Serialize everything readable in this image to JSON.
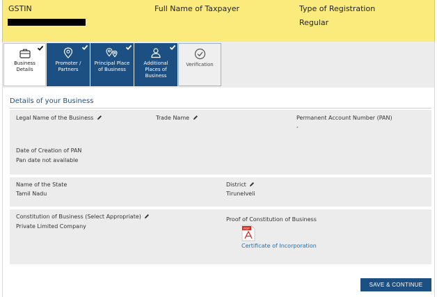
{
  "header": {
    "gstin_label": "GSTIN",
    "taxpayer_name_label": "Full Name of Taxpayer",
    "registration_type_label": "Type of Registration",
    "registration_type_value": "Regular"
  },
  "tabs": [
    {
      "label": "Business Details",
      "completed": true,
      "icon": "briefcase-icon"
    },
    {
      "label": "Promoter / Partners",
      "completed": true,
      "icon": "location-pin-icon"
    },
    {
      "label": "Principal Place of Business",
      "completed": true,
      "icon": "multi-location-icon"
    },
    {
      "label": "Additional Places of Business",
      "completed": true,
      "icon": "person-location-icon"
    },
    {
      "label": "Verification",
      "completed": false,
      "icon": "check-circle-icon"
    }
  ],
  "section": {
    "title": "Details of your Business"
  },
  "fields": {
    "legal_name_label": "Legal Name of the Business",
    "trade_name_label": "Trade Name",
    "pan_label": "Permanent Account Number (PAN)",
    "pan_value": ",",
    "pan_date_label": "Date of Creation of PAN",
    "pan_date_value": "Pan date not available",
    "state_label": "Name of the State",
    "state_value": "Tamil Nadu",
    "district_label": "District",
    "district_value": "Tirunelveli",
    "constitution_label": "Constitution of Business (Select Appropriate)",
    "constitution_value": "Private Limited Company",
    "proof_label": "Proof of Constitution of Business",
    "proof_file_badge": "PDF",
    "proof_link": "Certificate of Incorporation"
  },
  "actions": {
    "save_label": "SAVE & CONTINUE"
  },
  "colors": {
    "banner": "#fbeb7c",
    "tab_done": "#1c4f82",
    "button": "#1c4f82",
    "link": "#1f6fa8",
    "pdf_red": "#d42a24"
  }
}
